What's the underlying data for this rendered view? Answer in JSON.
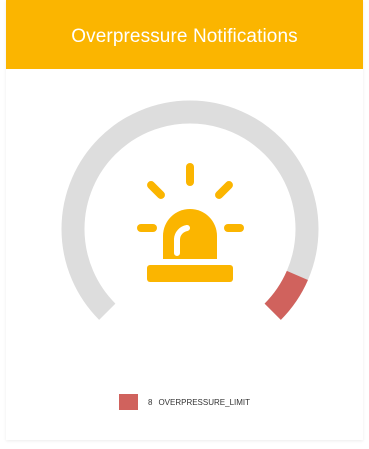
{
  "header": {
    "title": "Overpressure Notifications",
    "background_color": "#FBB500"
  },
  "gauge": {
    "icon": "alarm-siren-icon",
    "icon_color": "#FBB500",
    "track_color": "#DDDDDD",
    "value": 8,
    "value_fraction": 0.08,
    "fill_color": "#D0625D"
  },
  "legend": {
    "items": [
      {
        "count": "8",
        "label": "OVERPRESSURE_LIMIT",
        "color": "#D0625D"
      }
    ]
  }
}
